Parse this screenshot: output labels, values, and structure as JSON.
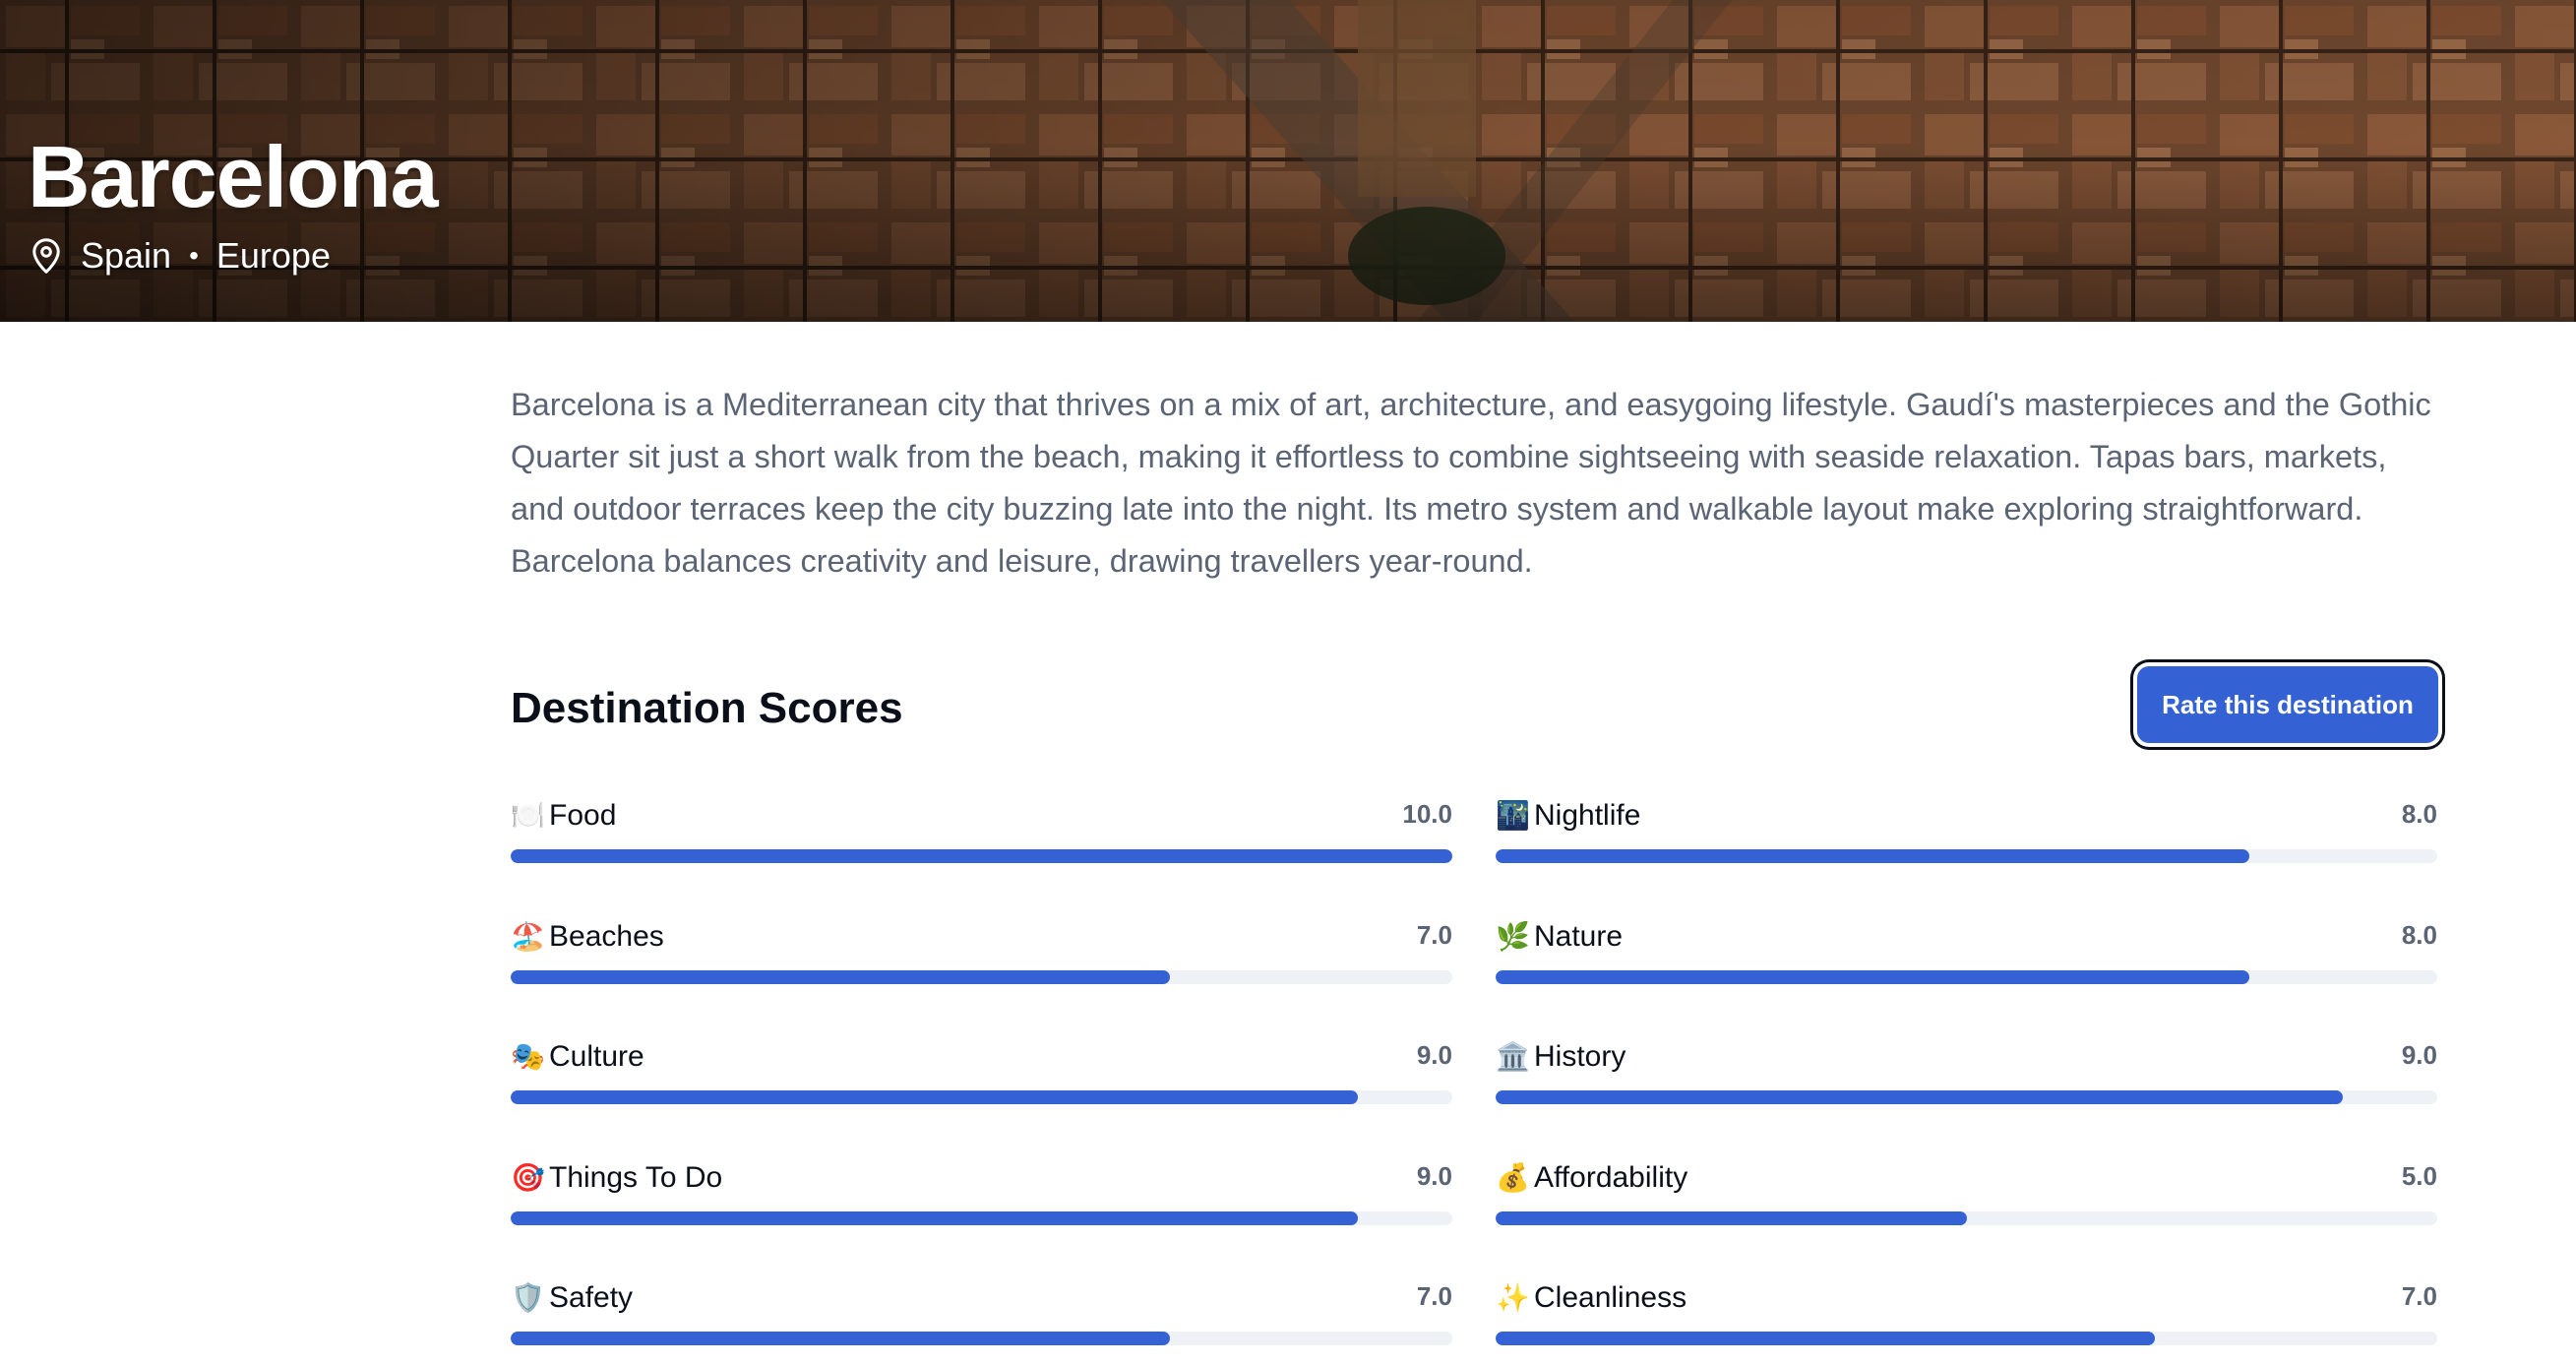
{
  "hero": {
    "title": "Barcelona",
    "country": "Spain",
    "separator": "•",
    "region": "Europe"
  },
  "description": "Barcelona is a Mediterranean city that thrives on a mix of art, architecture, and easygoing lifestyle. Gaudí's masterpieces and the Gothic Quarter sit just a short walk from the beach, making it effortless to combine sightseeing with seaside relaxation. Tapas bars, markets, and outdoor terraces keep the city buzzing late into the night. Its metro system and walkable layout make exploring straightforward. Barcelona balances creativity and leisure, drawing travellers year-round.",
  "scores": {
    "title": "Destination Scores",
    "rate_button": "Rate this destination",
    "max": 10,
    "accent_color": "#3461d4",
    "track_color": "#eef1f6",
    "items": [
      {
        "icon": "plate-icon",
        "emoji": "🍽️",
        "label": "Food",
        "value": "10.0"
      },
      {
        "icon": "city-night-icon",
        "emoji": "🌃",
        "label": "Nightlife",
        "value": "8.0"
      },
      {
        "icon": "beach-icon",
        "emoji": "🏖️",
        "label": "Beaches",
        "value": "7.0"
      },
      {
        "icon": "herb-icon",
        "emoji": "🌿",
        "label": "Nature",
        "value": "8.0"
      },
      {
        "icon": "theater-masks-icon",
        "emoji": "🎭",
        "label": "Culture",
        "value": "9.0"
      },
      {
        "icon": "classical-building-icon",
        "emoji": "🏛️",
        "label": "History",
        "value": "9.0"
      },
      {
        "icon": "dart-target-icon",
        "emoji": "🎯",
        "label": "Things To Do",
        "value": "9.0"
      },
      {
        "icon": "money-bag-icon",
        "emoji": "💰",
        "label": "Affordability",
        "value": "5.0"
      },
      {
        "icon": "shield-icon",
        "emoji": "🛡️",
        "label": "Safety",
        "value": "7.0"
      },
      {
        "icon": "sparkles-icon",
        "emoji": "✨",
        "label": "Cleanliness",
        "value": "7.0"
      }
    ]
  }
}
